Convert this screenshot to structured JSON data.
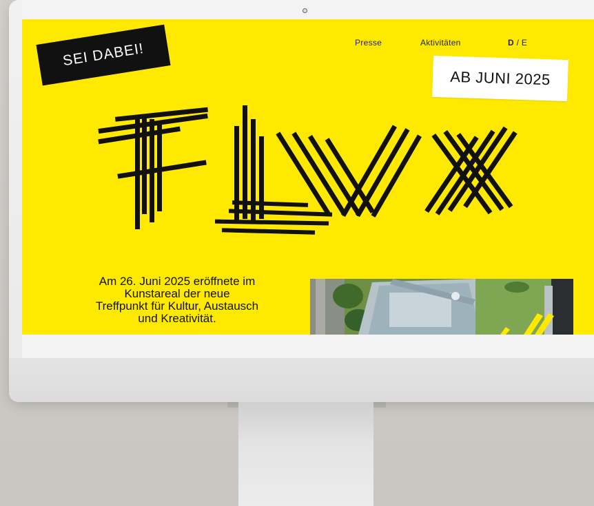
{
  "nav": {
    "press": "Presse",
    "activities": "Aktivitäten",
    "lang_active": "D",
    "lang_sep": " / ",
    "lang_other": "E"
  },
  "stickers": {
    "join": "SEI DABEI!",
    "date": "AB JUNI 2025"
  },
  "intro": {
    "line1": "Am 26. Juni 2025 eröffnete im",
    "line2": "Kunstareal der neue",
    "line3": "Treffpunkt für Kultur, Austausch",
    "line4": "und Kreativität."
  },
  "colors": {
    "brand_yellow": "#ffe900",
    "ink": "#111111",
    "paper": "#ffffff"
  },
  "icons": {
    "camera": "camera-dot-icon",
    "logo": "flux-logo"
  }
}
